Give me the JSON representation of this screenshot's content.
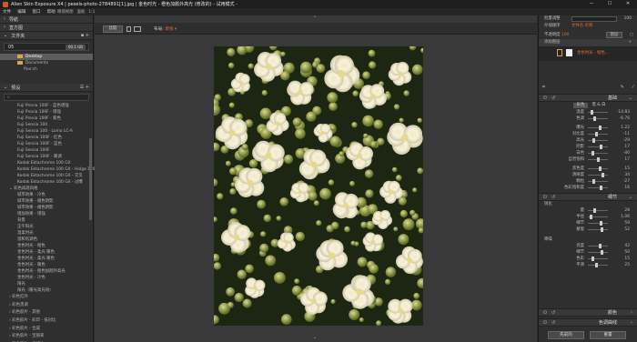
{
  "window": {
    "title": "Alien Skin Exposure X4 | pexels-photo-2784891[1].jpg | 金色时光 - 橙色加颜外高光 (修改的) - 试用模式 -",
    "controls": [
      "—",
      "☐",
      "✕"
    ]
  },
  "menu": {
    "items": [
      "文件",
      "编辑",
      "窗口",
      "帮助"
    ],
    "right_items": [
      "眼镜视图",
      "面板",
      "1:1"
    ]
  },
  "left": {
    "nav_title": "导航",
    "histogram_title": "直方图",
    "files_title": "文件夹",
    "path": "05",
    "path_btn": "00.1 GB",
    "folders": [
      "Desktop",
      "Documents",
      "fine:ch"
    ],
    "presets_title": "预设",
    "search_placeholder": "",
    "presets": [
      "Fuji Provia 100F - 蓝色增强",
      "Fuji Provia 100F - 增强",
      "Fuji Provia 100F - 紫色",
      "Fuji Sensia 100",
      "Fuji Sensia 100 - Lomo LC-A",
      "Fuji Sensia 100F - 红色",
      "Fuji Sensia 100F - 蓝色",
      "Fuji Sensia 100F",
      "Fuji Sensia 100F - 暖调",
      "Kodak Ektachrome 100 GX",
      "Kodak Ektachrome 100 GX - Holga 120",
      "Kodak Ektachrome 100 GX - 交叉",
      "Kodak Ektachrome 100 GX - 过曝"
    ],
    "group_title": "彩色再现风格",
    "group_items": [
      "城市效果 - 冷色",
      "城市效果 - 褪色阴影",
      "城市效果 - 褪色阴影",
      "增加效果 - 增强",
      "背景",
      "正午阳光",
      "温柔时光",
      "温和有调色",
      "金色时光 - 橙色",
      "金色时光 - 柔光 暖色",
      "金色时光 - 柔光 暖色",
      "金色时光 - 暖色",
      "金色时光 - 橙色加颜外高光",
      "金色时光 - 冷色",
      "阳光",
      "阳光（暖光高光效）"
    ],
    "categories": [
      "彩色红外",
      "彩色黑调",
      "彩色胶片 - 其他",
      "彩色胶片 - 彩印 - 低对比",
      "彩色胶片 - 合成",
      "彩色胶片 - 宝丽来",
      "彩色胶片 - 幻灯片"
    ]
  },
  "center": {
    "mode_btn": "比较",
    "layout_label": "布局:",
    "layout_value": "单张",
    "top_caret": "⌃",
    "bottom_caret": "⌄"
  },
  "right": {
    "stack_label": "批量调整",
    "stack_value": "100",
    "stack_label2": "存储顺序",
    "stack_value2": "文件名 名称",
    "opacity_label": "不透明度",
    "opacity_value": "100",
    "add_layer_label": "添加图层",
    "layer_btn": "图层",
    "layer_name": "金色时光 - 橙色...",
    "basic_title": "基础",
    "tabs": [
      "彩色",
      "黑 & 白"
    ],
    "basic_sliders": [
      {
        "label": "温度",
        "value": "-14.83"
      },
      {
        "label": "色调",
        "value": "-6.76"
      },
      {
        "label": "曝光",
        "value": "1.22"
      },
      {
        "label": "对比度",
        "value": "-11"
      },
      {
        "label": "高光",
        "value": "-29"
      },
      {
        "label": "阴影",
        "value": "17"
      },
      {
        "label": "白色",
        "value": "-40"
      },
      {
        "label": "自然饱和",
        "value": "17"
      },
      {
        "label": "黑色度",
        "value": "15"
      },
      {
        "label": "清晰度",
        "value": "34"
      },
      {
        "label": "颗粒",
        "value": "-27"
      },
      {
        "label": "色彩饱和度",
        "value": "16"
      }
    ],
    "detail_title": "细节",
    "sharpen_label": "锐化",
    "sharpen_sliders": [
      {
        "label": "量",
        "value": "28"
      },
      {
        "label": "半径",
        "value": "1.06"
      },
      {
        "label": "细节",
        "value": "59"
      },
      {
        "label": "蒙版",
        "value": "52"
      }
    ],
    "noise_label": "降噪",
    "noise_sliders": [
      {
        "label": "亮度",
        "value": "42"
      },
      {
        "label": "细节",
        "value": "50"
      },
      {
        "label": "色彩",
        "value": "15"
      },
      {
        "label": "平滑",
        "value": "25"
      }
    ],
    "color_title": "颜色",
    "curves_title": "色调曲线",
    "btn_prev": "先前的",
    "btn_reset": "重置"
  }
}
